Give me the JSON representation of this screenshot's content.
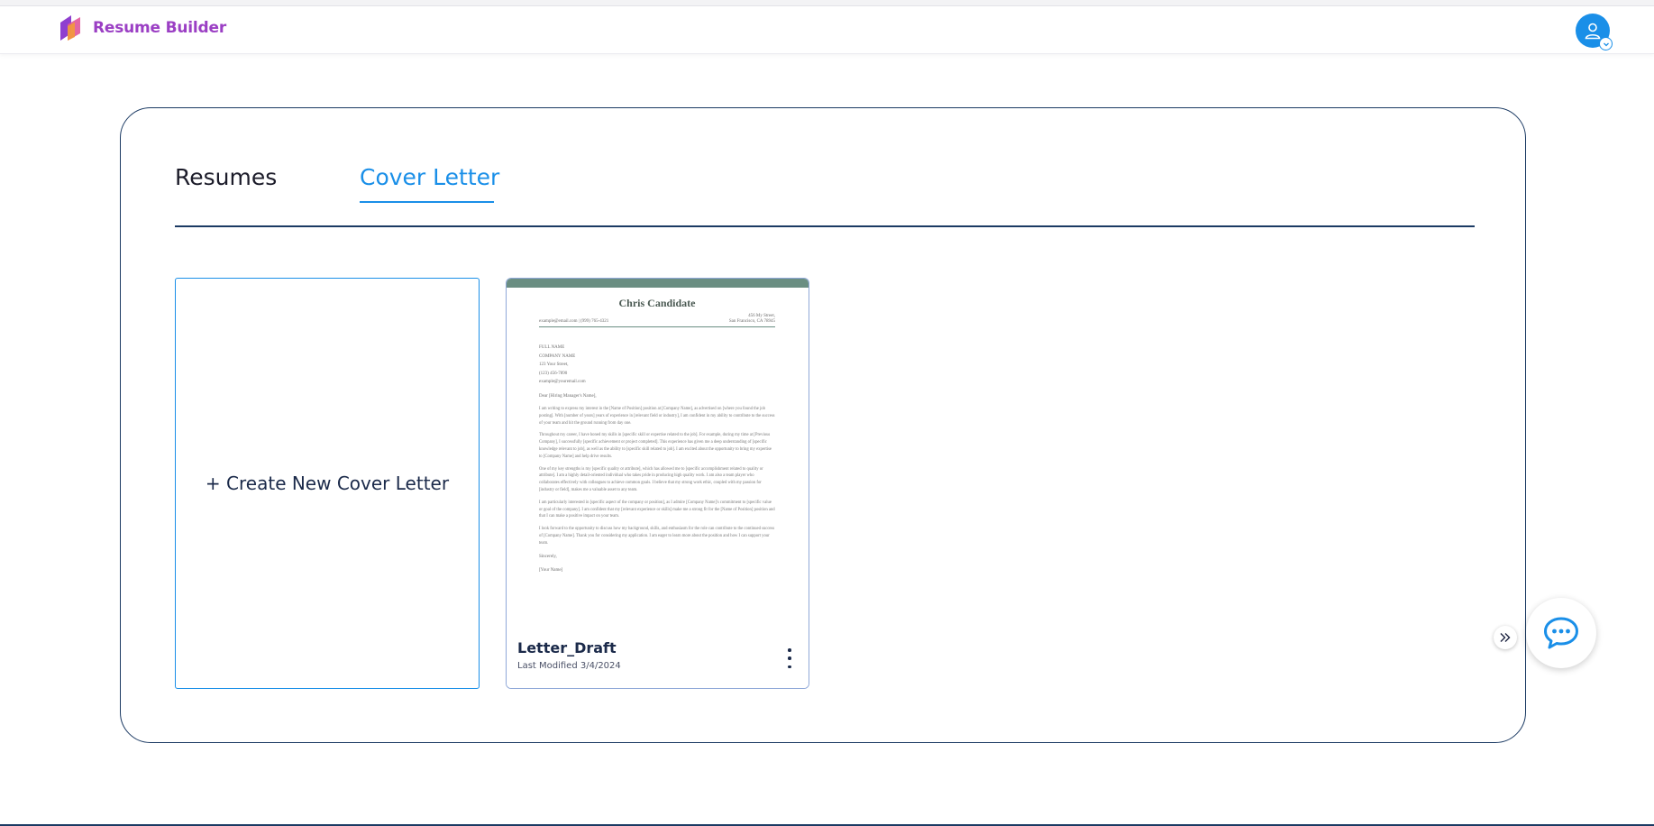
{
  "header": {
    "brand": "Resume Builder"
  },
  "tabs": [
    {
      "label": "Resumes",
      "active": false
    },
    {
      "label": "Cover Letter",
      "active": true
    }
  ],
  "create_card": {
    "label": "+ Create New Cover Letter"
  },
  "letters": [
    {
      "title": "Letter_Draft",
      "modified": "Last Modified 3/4/2024",
      "preview": {
        "name": "Chris Candidate",
        "address_line1": "456 My Street,",
        "contact": "example@email.com | (999) 765-4321",
        "address_line2": "San Francisco, CA 78945",
        "recipient": [
          "FULL NAME",
          "COMPANY NAME",
          "123 Your Street,",
          "(123) 456-7890",
          "example@youremail.com"
        ],
        "salutation": "Dear [Hiring Manager's Name],",
        "paragraphs": [
          "I am writing to express my interest in the [Name of Position] position at [Company Name], as advertised on [where you found the job posting]. With [number of years] years of experience in [relevant field or industry], I am confident in my ability to contribute to the success of your team and hit the ground running from day one.",
          "Throughout my career, I have honed my skills in [specific skill or expertise related to the job]. For example, during my time at [Previous Company], I successfully [specific achievement or project completed]. This experience has given me a deep understanding of [specific knowledge relevant to job], as well as the ability to [specific skill related to job]. I am excited about the opportunity to bring my expertise to [Company Name] and help drive results.",
          "One of my key strengths is my [specific quality or attribute], which has allowed me to [specific accomplishment related to quality or attribute]. I am a highly detail-oriented individual who takes pride in producing high quality work. I am also a team player who collaborates effectively with colleagues to achieve common goals. I believe that my strong work ethic, coupled with my passion for [industry or field], makes me a valuable asset to any team.",
          "I am particularly interested in [specific aspect of the company or position], as I admire [Company Name]'s commitment to [specific value or goal of the company]. I am confident that my [relevant experience or skills] make me a strong fit for the [Name of Position] position and that I can make a positive impact on your team.",
          "I look forward to the opportunity to discuss how my background, skills, and enthusiasm for the role can contribute to the continued success of [Company Name]. Thank you for considering my application. I am eager to learn more about the position and how I can support your team."
        ],
        "closing": "Sincerely,",
        "signature": "[Your Name]"
      }
    }
  ],
  "colors": {
    "accent": "#1a8fe8",
    "brand": "#9b3fc4",
    "panel_border": "#1b3a63",
    "letter_header": "#6a8e82"
  },
  "icons": {
    "logo": "resume-builder-logo",
    "avatar": "user-icon",
    "avatar_badge": "chevron-down-icon",
    "expand": "double-chevron-right-icon",
    "chat": "chat-bubble-icon",
    "menu": "kebab-menu-icon"
  }
}
